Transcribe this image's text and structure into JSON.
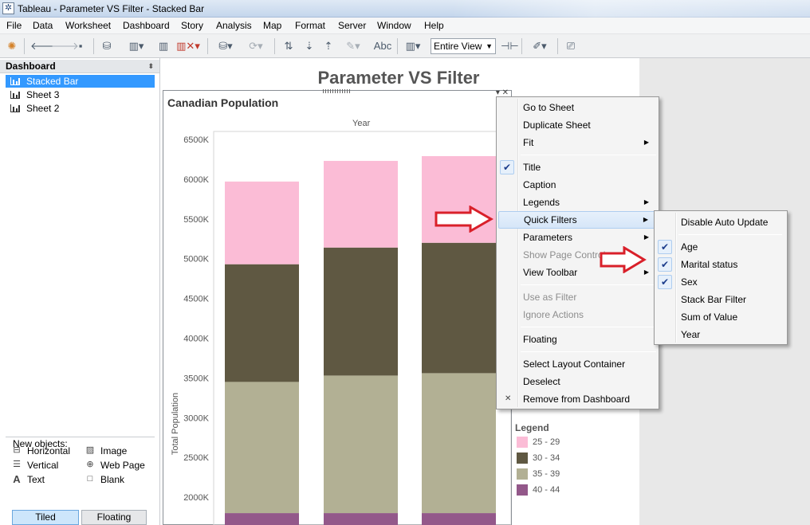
{
  "window": {
    "title": "Tableau - Parameter VS Filter - Stacked Bar"
  },
  "menu": [
    "File",
    "Data",
    "Worksheet",
    "Dashboard",
    "Story",
    "Analysis",
    "Map",
    "Format",
    "Server",
    "Window",
    "Help"
  ],
  "toolbar": {
    "abc_label": "Abc",
    "fit_select": "Entire View"
  },
  "dashboard_pane": {
    "header": "Dashboard",
    "sheets": [
      {
        "label": "Stacked Bar",
        "selected": true
      },
      {
        "label": "Sheet 3",
        "selected": false
      },
      {
        "label": "Sheet 2",
        "selected": false
      }
    ],
    "objects": [
      "Horizontal",
      "Image",
      "Vertical",
      "Web Page",
      "Text",
      "Blank"
    ],
    "new_objects_label": "New objects:",
    "tiled_label": "Tiled",
    "floating_label": "Floating"
  },
  "dashboard": {
    "title": "Parameter VS Filter"
  },
  "chart_data": {
    "type": "bar",
    "stacked": true,
    "title": "Canadian Population",
    "top_label": "Year",
    "ylabel": "Total Population",
    "yticks": [
      "6500K",
      "6000K",
      "5500K",
      "5000K",
      "4500K",
      "4000K",
      "3500K",
      "3000K",
      "2500K",
      "2000K"
    ],
    "ylim": [
      1650,
      6700
    ],
    "series": [
      {
        "name": "40 - 44",
        "color": "#93588a",
        "values": [
          1800,
          1800,
          1800
        ]
      },
      {
        "name": "35 - 39",
        "color": "#b2b094",
        "values": [
          1650,
          1730,
          1760
        ]
      },
      {
        "name": "30 - 34",
        "color": "#5f5842",
        "values": [
          1480,
          1610,
          1640
        ]
      },
      {
        "name": "25 - 29",
        "color": "#fbbcd6",
        "values": [
          1040,
          1090,
          1090
        ]
      }
    ]
  },
  "legend": {
    "title": "Legend",
    "items": [
      {
        "label": "25 - 29",
        "color": "#fbbcd6"
      },
      {
        "label": "30 - 34",
        "color": "#5f5842"
      },
      {
        "label": "35 - 39",
        "color": "#b2b094"
      },
      {
        "label": "40 - 44",
        "color": "#93588a"
      }
    ]
  },
  "context_menu": {
    "go_to_sheet": "Go to Sheet",
    "duplicate_sheet": "Duplicate Sheet",
    "fit": "Fit",
    "title": "Title",
    "caption": "Caption",
    "legends": "Legends",
    "quick_filters": "Quick Filters",
    "parameters": "Parameters",
    "show_page_control": "Show Page Control",
    "view_toolbar": "View Toolbar",
    "use_as_filter": "Use as Filter",
    "ignore_actions": "Ignore Actions",
    "floating": "Floating",
    "select_layout_container": "Select Layout Container",
    "deselect": "Deselect",
    "remove_from_dashboard": "Remove from Dashboard"
  },
  "quick_filters_menu": {
    "disable_auto_update": "Disable Auto Update",
    "age": "Age",
    "marital_status": "Marital status",
    "sex": "Sex",
    "stack_bar_filter": "Stack Bar Filter",
    "sum_of_value": "Sum of Value",
    "year": "Year"
  },
  "colors": {
    "selection": "#3399ff",
    "arrow": "#d9202a"
  }
}
